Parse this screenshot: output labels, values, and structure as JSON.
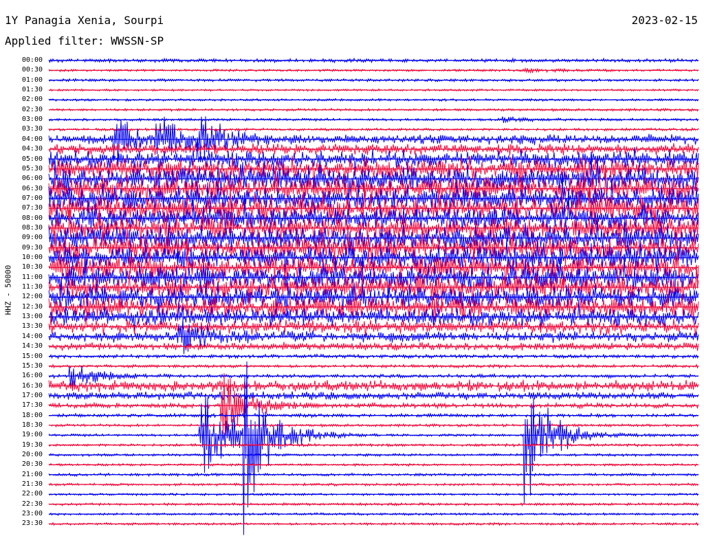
{
  "header": {
    "station": "1Y Panagia Xenia, Sourpi",
    "date": "2023-02-15",
    "filter": "Applied filter: WWSSN-SP",
    "sensor": "HHZ - 50000"
  },
  "colors": {
    "trace_a": "#0000ee",
    "trace_b": "#ee0a3c"
  },
  "chart_data": {
    "type": "helicorder",
    "title": "1Y Panagia Xenia, Sourpi",
    "subtitle": "Applied filter: WWSSN-SP",
    "date": "2023-02-15",
    "ylabel": "HHZ - 50000",
    "line_minutes": 30,
    "grid": false,
    "rows": [
      {
        "time": "00:00",
        "activity": 0.12
      },
      {
        "time": "00:30",
        "activity": 0.06
      },
      {
        "time": "01:00",
        "activity": 0.08
      },
      {
        "time": "01:30",
        "activity": 0.05
      },
      {
        "time": "02:00",
        "activity": 0.06
      },
      {
        "time": "02:30",
        "activity": 0.07
      },
      {
        "time": "03:00",
        "activity": 0.07
      },
      {
        "time": "03:30",
        "activity": 0.08
      },
      {
        "time": "04:00",
        "activity": 0.4
      },
      {
        "time": "04:30",
        "activity": 0.45
      },
      {
        "time": "05:00",
        "activity": 0.7
      },
      {
        "time": "05:30",
        "activity": 0.95
      },
      {
        "time": "06:00",
        "activity": 1.0
      },
      {
        "time": "06:30",
        "activity": 1.0
      },
      {
        "time": "07:00",
        "activity": 1.0
      },
      {
        "time": "07:30",
        "activity": 1.0
      },
      {
        "time": "08:00",
        "activity": 1.0
      },
      {
        "time": "08:30",
        "activity": 1.0
      },
      {
        "time": "09:00",
        "activity": 1.0
      },
      {
        "time": "09:30",
        "activity": 1.0
      },
      {
        "time": "10:00",
        "activity": 1.0
      },
      {
        "time": "10:30",
        "activity": 1.0
      },
      {
        "time": "11:00",
        "activity": 1.0
      },
      {
        "time": "11:30",
        "activity": 1.0
      },
      {
        "time": "12:00",
        "activity": 1.0
      },
      {
        "time": "12:30",
        "activity": 0.9
      },
      {
        "time": "13:00",
        "activity": 0.7
      },
      {
        "time": "13:30",
        "activity": 0.55
      },
      {
        "time": "14:00",
        "activity": 0.45
      },
      {
        "time": "14:30",
        "activity": 0.3
      },
      {
        "time": "15:00",
        "activity": 0.12
      },
      {
        "time": "15:30",
        "activity": 0.1
      },
      {
        "time": "16:00",
        "activity": 0.12
      },
      {
        "time": "16:30",
        "activity": 0.45
      },
      {
        "time": "17:00",
        "activity": 0.3
      },
      {
        "time": "17:30",
        "activity": 0.18
      },
      {
        "time": "18:00",
        "activity": 0.12
      },
      {
        "time": "18:30",
        "activity": 0.08
      },
      {
        "time": "19:00",
        "activity": 0.07
      },
      {
        "time": "19:30",
        "activity": 0.08
      },
      {
        "time": "20:00",
        "activity": 0.07
      },
      {
        "time": "20:30",
        "activity": 0.06
      },
      {
        "time": "21:00",
        "activity": 0.08
      },
      {
        "time": "21:30",
        "activity": 0.07
      },
      {
        "time": "22:00",
        "activity": 0.06
      },
      {
        "time": "22:30",
        "activity": 0.07
      },
      {
        "time": "23:00",
        "activity": 0.06
      },
      {
        "time": "23:30",
        "activity": 0.07
      }
    ],
    "events": [
      {
        "time": "00:30",
        "minute": 22,
        "amplitude": 0.3
      },
      {
        "time": "03:00",
        "minute": 21,
        "amplitude": 0.3
      },
      {
        "time": "04:00",
        "minute": 3,
        "amplitude": 3.0
      },
      {
        "time": "04:00",
        "minute": 5,
        "amplitude": 2.8
      },
      {
        "time": "04:00",
        "minute": 7,
        "amplitude": 2.5
      },
      {
        "time": "14:00",
        "minute": 6,
        "amplitude": 2.6
      },
      {
        "time": "16:00",
        "minute": 1,
        "amplitude": 1.8
      },
      {
        "time": "17:30",
        "minute": 8,
        "amplitude": 4.5
      },
      {
        "time": "19:00",
        "minute": 7,
        "amplitude": 8.5
      },
      {
        "time": "19:00",
        "minute": 9,
        "amplitude": 9.5
      },
      {
        "time": "19:00",
        "minute": 22,
        "amplitude": 8.0
      }
    ]
  }
}
